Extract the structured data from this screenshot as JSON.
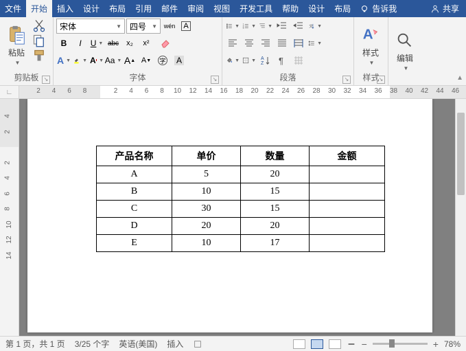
{
  "titlebar": {
    "tabs": [
      "文件",
      "开始",
      "插入",
      "设计",
      "布局",
      "引用",
      "邮件",
      "审阅",
      "视图",
      "开发工具",
      "帮助",
      "设计",
      "布局"
    ],
    "active_index": 1,
    "tellme": "告诉我",
    "share": "共享"
  },
  "ribbon": {
    "clipboard": {
      "label": "剪贴板",
      "paste": "粘贴"
    },
    "font": {
      "label": "字体",
      "name": "宋体",
      "size": "四号",
      "bold": "B",
      "italic": "I",
      "underline": "U",
      "strike": "abc",
      "sub": "x₂",
      "sup": "x²",
      "textfx": "A",
      "highlight": "",
      "color": "A",
      "case": "Aa",
      "phonetic": "wén",
      "charborder": "A",
      "grow": "A",
      "shrink": "A",
      "clear": "",
      "circled": "字",
      "shading": "A"
    },
    "paragraph": {
      "label": "段落"
    },
    "styles": {
      "label": "样式",
      "btn": "样式"
    },
    "editing": {
      "label": "编辑",
      "btn": "编辑"
    }
  },
  "ruler": {
    "h_left": [
      "8",
      "6",
      "4",
      "2"
    ],
    "h_right": [
      "2",
      "4",
      "6",
      "8",
      "10",
      "12",
      "14",
      "16",
      "18",
      "20",
      "22",
      "24",
      "26",
      "28",
      "30",
      "32",
      "34",
      "36",
      "38",
      "40",
      "42",
      "44",
      "46"
    ],
    "v": [
      "4",
      "2",
      "2",
      "4",
      "6",
      "8",
      "10",
      "12",
      "14"
    ]
  },
  "table": {
    "headers": [
      "产品名称",
      "单价",
      "数量",
      "金额"
    ],
    "rows": [
      [
        "A",
        "5",
        "20",
        ""
      ],
      [
        "B",
        "10",
        "15",
        ""
      ],
      [
        "C",
        "30",
        "15",
        ""
      ],
      [
        "D",
        "20",
        "20",
        ""
      ],
      [
        "E",
        "10",
        "17",
        ""
      ]
    ]
  },
  "status": {
    "page": "第 1 页，共 1 页",
    "words": "3/25 个字",
    "lang": "英语(美国)",
    "mode": "插入",
    "zoom": "78%"
  }
}
